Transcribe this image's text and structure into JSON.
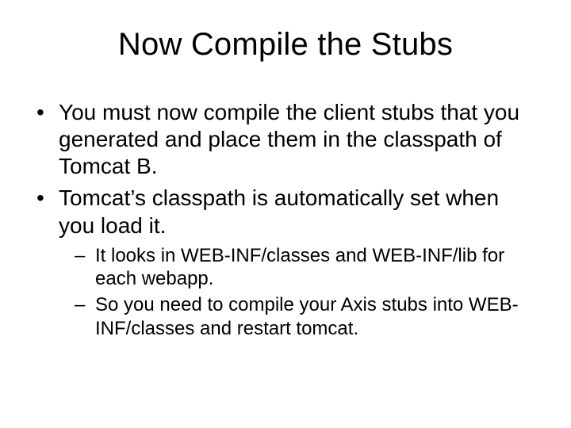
{
  "title": "Now Compile the Stubs",
  "bullets": [
    "You must now compile the client stubs that you generated and place them in the classpath of Tomcat B.",
    "Tomcat’s classpath is automatically set when you load it."
  ],
  "subbullets": [
    "It looks in WEB-INF/classes and WEB-INF/lib for each webapp.",
    "So you need to compile your Axis stubs into WEB-INF/classes and restart tomcat."
  ]
}
